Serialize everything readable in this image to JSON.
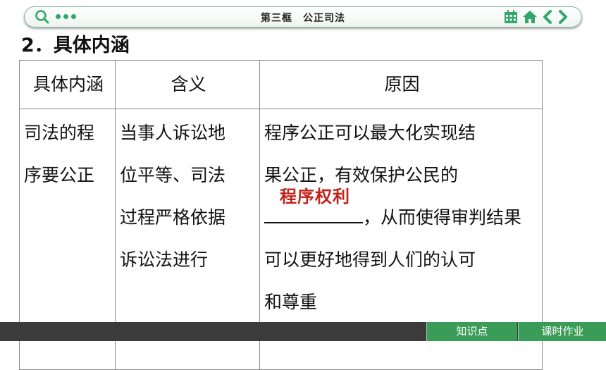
{
  "header": {
    "title": "第三框　公正司法",
    "icons": [
      "search-icon",
      "more-dots-icon",
      "calendar-grid-icon",
      "home-icon",
      "chevron-left-icon",
      "chevron-right-icon"
    ],
    "accent_color": "#2fa86a"
  },
  "heading": "2．具体内涵",
  "table": {
    "columns": [
      "具体内涵",
      "含义",
      "原因"
    ],
    "row": {
      "col1_lines": [
        "司法的程",
        "序要公正"
      ],
      "col2_lines": [
        "当事人诉讼地",
        "位平等、司法",
        "过程严格依据",
        "诉讼法进行"
      ],
      "col3_line1": "程序公正可以最大化实现结",
      "col3_line2": "果公正，有效保护公民的",
      "blank_answer": "程序权利",
      "col3_line3_after": "，从而使得审判结果",
      "col3_line4": "可以更好地得到人们的认可",
      "col3_line5": "和尊重"
    },
    "answer_color": "#c0241c"
  },
  "footer": {
    "knowledge_label": "知识点",
    "homework_label": "课时作业"
  }
}
